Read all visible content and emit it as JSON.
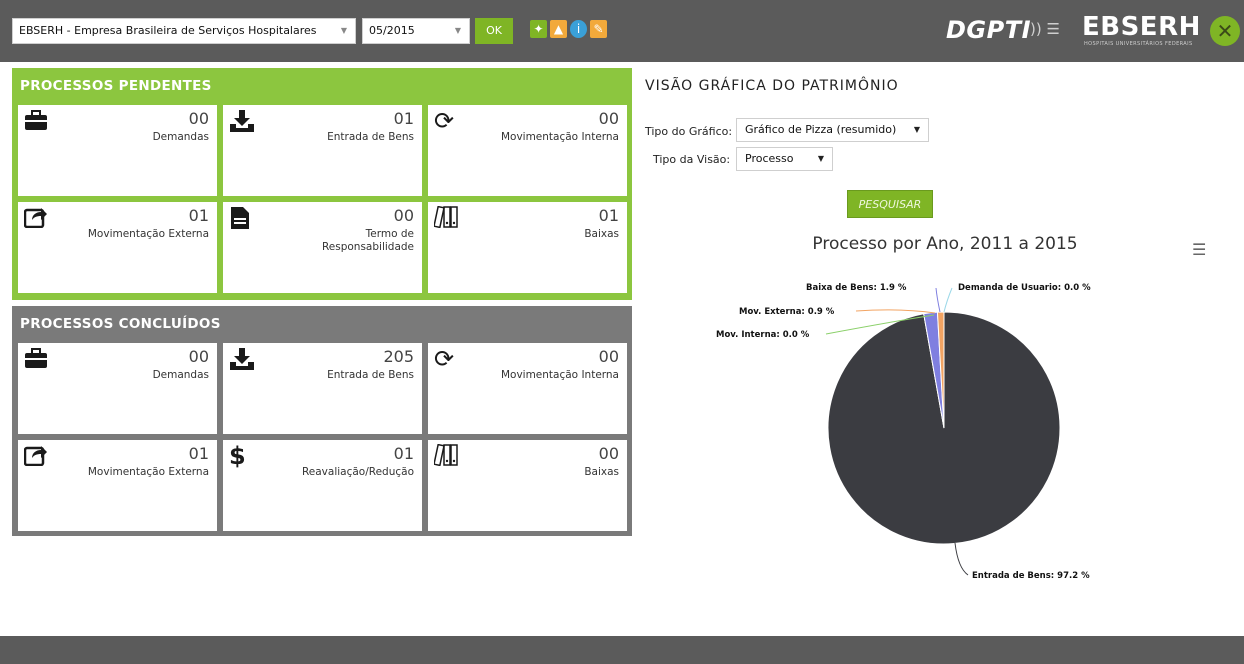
{
  "header": {
    "org_select": "EBSERH - Empresa Brasileira de Serviços Hospitalares",
    "period_select": "05/2015",
    "ok_label": "OK",
    "brand_dgpti": "DGPTI",
    "brand_ebserh": "EBSERH",
    "brand_subtitle": "HOSPITAIS UNIVERSITÁRIOS FEDERAIS",
    "icons": [
      "brazil-map-icon",
      "chart-icon",
      "info-icon",
      "edit-icon"
    ]
  },
  "pending": {
    "title": "PROCESSOS PENDENTES",
    "tiles": [
      {
        "icon": "briefcase-icon",
        "count": "00",
        "label": "Demandas"
      },
      {
        "icon": "download-icon",
        "count": "01",
        "label": "Entrada de Bens"
      },
      {
        "icon": "refresh-icon",
        "count": "00",
        "label": "Movimentação Interna"
      },
      {
        "icon": "share-icon",
        "count": "01",
        "label": "Movimentação Externa"
      },
      {
        "icon": "document-icon",
        "count": "00",
        "label": "Termo de Responsabilidade"
      },
      {
        "icon": "archive-icon",
        "count": "01",
        "label": "Baixas"
      }
    ]
  },
  "done": {
    "title": "PROCESSOS CONCLUÍDOS",
    "tiles": [
      {
        "icon": "briefcase-icon",
        "count": "00",
        "label": "Demandas"
      },
      {
        "icon": "download-icon",
        "count": "205",
        "label": "Entrada de Bens"
      },
      {
        "icon": "refresh-icon",
        "count": "00",
        "label": "Movimentação Interna"
      },
      {
        "icon": "share-icon",
        "count": "01",
        "label": "Movimentação Externa"
      },
      {
        "icon": "dollar-icon",
        "count": "01",
        "label": "Reavaliação/Redução"
      },
      {
        "icon": "archive-icon",
        "count": "00",
        "label": "Baixas"
      }
    ]
  },
  "chart_panel": {
    "title": "VISÃO GRÁFICA DO PATRIMÔNIO",
    "tipo_grafico_label": "Tipo do Gráfico:",
    "tipo_grafico_value": "Gráfico de Pizza (resumido)",
    "tipo_visao_label": "Tipo da Visão:",
    "tipo_visao_value": "Processo",
    "search_label": "PESQUISAR"
  },
  "chart_data": {
    "type": "pie",
    "title": "Processo por Ano, 2011 a 2015",
    "slices": [
      {
        "name": "Entrada de Bens",
        "value": 97.2,
        "color": "#3b3c41"
      },
      {
        "name": "Mov. Interna",
        "value": 0.0,
        "color": "#8bd06a"
      },
      {
        "name": "Mov. Externa",
        "value": 0.9,
        "color": "#f2a463"
      },
      {
        "name": "Baixa de Bens",
        "value": 1.9,
        "color": "#7f7fe0"
      },
      {
        "name": "Demanda de Usuario",
        "value": 0.0,
        "color": "#9bd8e8"
      }
    ],
    "labels": [
      "Entrada de Bens: 97.2 %",
      "Mov. Interna: 0.0 %",
      "Mov. Externa: 0.9 %",
      "Baixa de Bens: 1.9 %",
      "Demanda de Usuario: 0.0 %"
    ]
  },
  "colors": {
    "accent_green": "#8cc63f",
    "header_gray": "#5b5b5b",
    "panel_gray": "#7a7a7a"
  }
}
